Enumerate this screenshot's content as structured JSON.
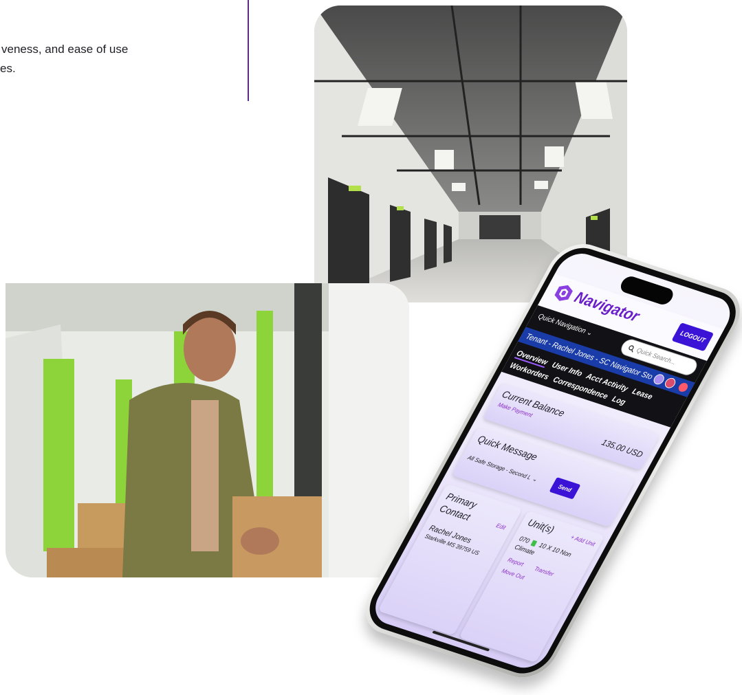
{
  "intro": {
    "line1": "veness, and ease of use",
    "line2": "es."
  },
  "app": {
    "logo_text": "Navigator",
    "logout_label": "LOGOUT",
    "quick_nav_label": "Quick Navigation ⌄",
    "search_placeholder": "Quick Search...",
    "tenant_label": "Tenant - Rachel Jones - SC Navigator Sto",
    "tabs": [
      "Overview",
      "User Info",
      "Acct Activity",
      "Lease",
      "Workorders",
      "Correspondence",
      "Log"
    ],
    "balance": {
      "title": "Current Balance",
      "link": "Make Payment",
      "amount": "135.00 USD"
    },
    "message": {
      "title": "Quick Message",
      "selected": "All Safe Storage - Second L",
      "send_label": "Send"
    },
    "contact": {
      "title": "Primary Contact",
      "edit_label": "Edit",
      "name": "Rachel Jones",
      "address": "Starkville MS 39759 US"
    },
    "units": {
      "title": "Unit(s)",
      "add_label": "+ Add Unit",
      "unit_number": "070",
      "unit_size": "10 X 10 Non",
      "unit_type": "Climate",
      "links": [
        "Report",
        "Transfer",
        "Move Out"
      ]
    }
  },
  "colors": {
    "accent": "#3a13d6",
    "brand": "#6a1fc9",
    "green_doors": "#8cd43a",
    "divider": "#5b2a86"
  }
}
